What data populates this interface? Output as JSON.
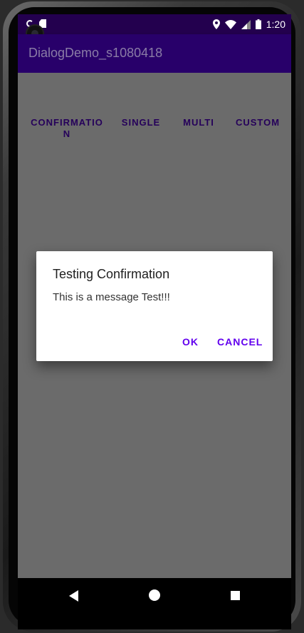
{
  "status_bar": {
    "time": "1:20",
    "icons": [
      "sync-icon",
      "sd-card-icon",
      "location-icon",
      "wifi-icon",
      "signal-icon",
      "battery-icon"
    ]
  },
  "app_bar": {
    "title": "DialogDemo_s1080418"
  },
  "buttons": {
    "confirmation": "CONFIRMATIO\nN",
    "single": "SINGLE",
    "multi": "MULTI",
    "custom": "CUSTOM"
  },
  "dialog": {
    "title": "Testing Confirmation",
    "message": "This is a message Test!!!",
    "ok_label": "OK",
    "cancel_label": "CANCEL"
  },
  "nav_bar": {
    "icons": [
      "back-icon",
      "home-icon",
      "recents-icon"
    ]
  },
  "colors": {
    "app_bar": "#28006a",
    "status_bar": "#23004e",
    "dim_background": "#6b6b6b",
    "accent": "#6200ee"
  }
}
